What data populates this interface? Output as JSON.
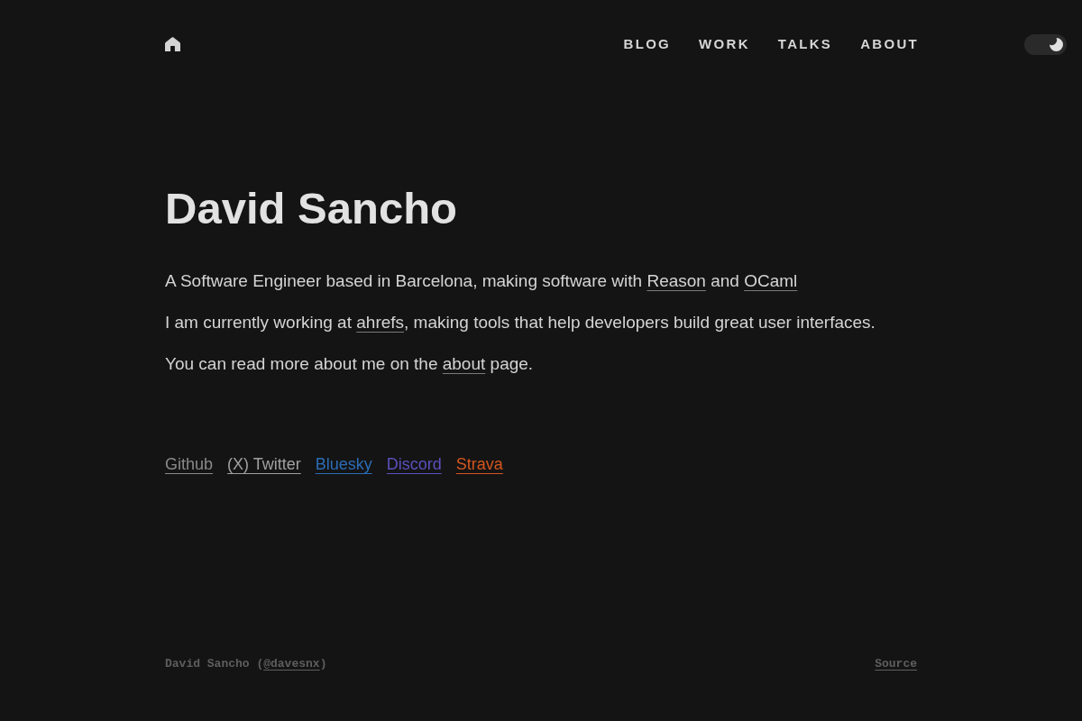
{
  "nav": [
    "BLOG",
    "WORK",
    "TALKS",
    "ABOUT"
  ],
  "theme_toggle": {
    "on": true
  },
  "title": "David Sancho",
  "paragraphs": [
    {
      "parts": [
        {
          "kind": "text",
          "text": "A Software Engineer based in Barcelona, making software with "
        },
        {
          "kind": "link",
          "text": "Reason"
        },
        {
          "kind": "text",
          "text": " and "
        },
        {
          "kind": "link",
          "text": "OCaml"
        }
      ]
    },
    {
      "parts": [
        {
          "kind": "text",
          "text": "I am currently working at "
        },
        {
          "kind": "link",
          "text": "ahrefs"
        },
        {
          "kind": "text",
          "text": ", making tools that help developers build great user interfaces."
        }
      ]
    },
    {
      "parts": [
        {
          "kind": "text",
          "text": "You can read more about me on the "
        },
        {
          "kind": "link",
          "text": "about"
        },
        {
          "kind": "text",
          "text": " page."
        }
      ]
    }
  ],
  "social_links": [
    {
      "label": "Github",
      "color": "#8a8a8a"
    },
    {
      "label": "(X) Twitter",
      "color": "#a0a0a0"
    },
    {
      "label": "Bluesky",
      "color": "#2b6cb5"
    },
    {
      "label": "Discord",
      "color": "#5b50bd"
    },
    {
      "label": "Strava",
      "color": "#d4561f"
    }
  ],
  "footer": {
    "credit": [
      {
        "kind": "text",
        "text": "David Sancho ("
      },
      {
        "kind": "link",
        "text": "@davesnx"
      },
      {
        "kind": "text",
        "text": ")"
      }
    ],
    "source_link": "Source"
  }
}
